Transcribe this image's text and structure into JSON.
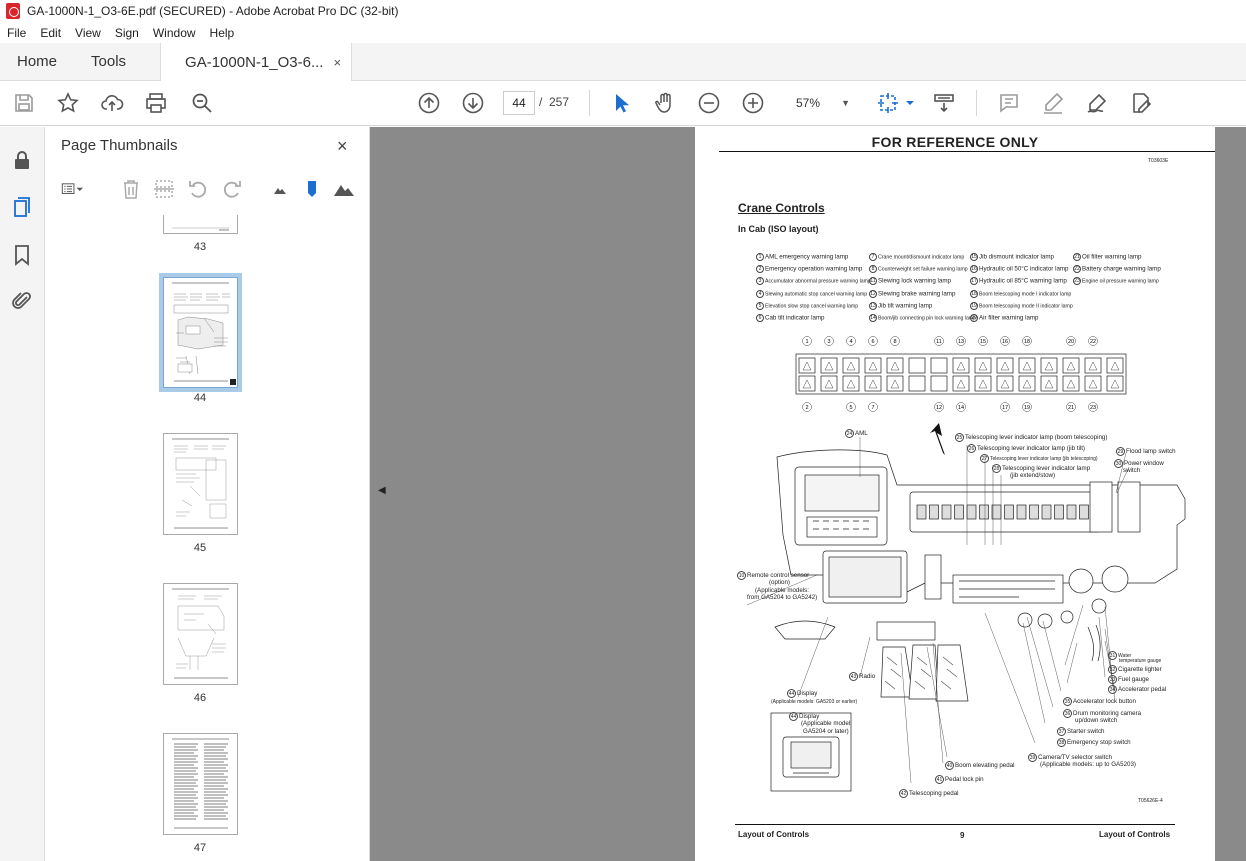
{
  "window": {
    "title": "GA-1000N-1_O3-6E.pdf (SECURED) - Adobe Acrobat Pro DC (32-bit)"
  },
  "menu": [
    "File",
    "Edit",
    "View",
    "Sign",
    "Window",
    "Help"
  ],
  "tabs": {
    "home": "Home",
    "tools": "Tools",
    "document": "GA-1000N-1_O3-6...",
    "close": "×"
  },
  "toolbar": {
    "page_current": "44",
    "page_separator": "/",
    "page_total": "257",
    "zoom": "57%"
  },
  "thumbnails": {
    "title": "Page Thumbnails",
    "close": "×",
    "pages": [
      "43",
      "44",
      "45",
      "46",
      "47"
    ],
    "selected": "44"
  },
  "document": {
    "header": "FOR REFERENCE ONLY",
    "code": "T03603E",
    "section_title": "Crane Controls",
    "section_subtitle": "In Cab (ISO layout)",
    "legend": [
      {
        "n": "1",
        "t": "AML emergency warning lamp"
      },
      {
        "n": "2",
        "t": "Emergency operation warning lamp"
      },
      {
        "n": "3",
        "t": "Accumulator abnormal pressure warning lamp"
      },
      {
        "n": "4",
        "t": "Slewing automatic stop cancel warning lamp"
      },
      {
        "n": "5",
        "t": "Elevation slow stop cancel warning lamp"
      },
      {
        "n": "6",
        "t": "Cab tilt indicator lamp"
      },
      {
        "n": "7",
        "t": "Crane mount/dismount indicator lamp"
      },
      {
        "n": "8",
        "t": "Counterweight set failure warning lamp"
      },
      {
        "n": "11",
        "t": "Slewing lock warning lamp"
      },
      {
        "n": "12",
        "t": "Slewing brake warning lamp"
      },
      {
        "n": "13",
        "t": "Jib tilt warning lamp"
      },
      {
        "n": "14",
        "t": "Boom/jib connecting pin lock warning lamp"
      },
      {
        "n": "15",
        "t": "Jib dismount indicator lamp"
      },
      {
        "n": "16",
        "t": "Hydraulic oil 50°C indicator lamp"
      },
      {
        "n": "17",
        "t": "Hydraulic oil 85°C warning lamp"
      },
      {
        "n": "18",
        "t": "Boom telescoping mode I indicator lamp"
      },
      {
        "n": "19",
        "t": "Boom telescoping mode II indicator lamp"
      },
      {
        "n": "20",
        "t": "Air filter warning lamp"
      },
      {
        "n": "21",
        "t": "Oil filter warning lamp"
      },
      {
        "n": "22",
        "t": "Battery charge warning lamp"
      },
      {
        "n": "23",
        "t": "Engine oil pressure warning lamp"
      }
    ],
    "lamp_top_numbers": [
      "1",
      "3",
      "4",
      "6",
      "8",
      "11",
      "13",
      "15",
      "16",
      "18",
      "20",
      "22"
    ],
    "lamp_bottom_numbers": [
      "2",
      "5",
      "7",
      "12",
      "14",
      "17",
      "19",
      "21",
      "23"
    ],
    "callouts": {
      "c24": {
        "n": "24",
        "t": "AML"
      },
      "c25": {
        "n": "25",
        "t": "Telescoping lever indicator lamp (boom telescoping)"
      },
      "c26": {
        "n": "26",
        "t": "Telescoping lever indicator lamp (jib tilt)"
      },
      "c27": {
        "n": "27",
        "t": "Telescoping lever indicator lamp (jib telescoping)"
      },
      "c28": {
        "n": "28",
        "t": "Telescoping lever indicator lamp"
      },
      "c28b": "(jib extend/stow)",
      "c29": {
        "n": "29",
        "t": "Flood lamp switch"
      },
      "c30": {
        "n": "30",
        "t": "Power window"
      },
      "c30b": "switch",
      "c10": {
        "n": "10",
        "t": "Remote control sensor"
      },
      "c10b": "(option)",
      "c10c": "(Applicable models:",
      "c10d": "from GA5204 to GA5242)",
      "c43": {
        "n": "43",
        "t": "Radio"
      },
      "c44a": {
        "n": "44",
        "t": "Display"
      },
      "c44a2": "(Applicable models: GA5203 or earlier)",
      "c44b": {
        "n": "44",
        "t": "Display"
      },
      "c44b2": "(Applicable model:",
      "c44b3": "GA5204 or later)",
      "c31": {
        "n": "31",
        "t": "Water"
      },
      "c31b": "temperature gauge",
      "c32": {
        "n": "32",
        "t": "Cigarette lighter"
      },
      "c33": {
        "n": "33",
        "t": "Fuel gauge"
      },
      "c34": {
        "n": "34",
        "t": "Accelerator pedal"
      },
      "c35": {
        "n": "35",
        "t": "Accelerator lock button"
      },
      "c36": {
        "n": "36",
        "t": "Drum monitoring camera"
      },
      "c36b": "up/down switch",
      "c37": {
        "n": "37",
        "t": "Starter switch"
      },
      "c38": {
        "n": "38",
        "t": "Emergency stop switch"
      },
      "c39": {
        "n": "39",
        "t": "Camera/TV selector switch"
      },
      "c39b": "(Applicable models: up to GA5203)",
      "c40": {
        "n": "40",
        "t": "Boom elevating pedal"
      },
      "c41": {
        "n": "41",
        "t": "Pedal lock pin"
      },
      "c42": {
        "n": "42",
        "t": "Telescoping pedal"
      }
    },
    "figure_code": "T05626E-4",
    "footer_left": "Layout of Controls",
    "footer_page": "9",
    "footer_right": "Layout of Controls"
  }
}
